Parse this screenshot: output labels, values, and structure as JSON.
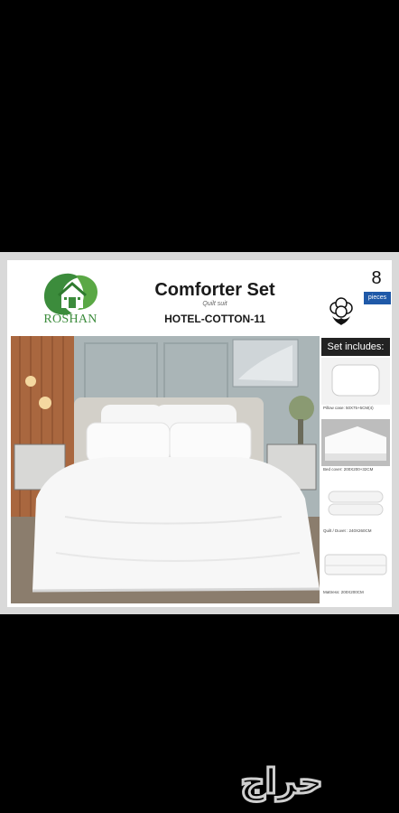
{
  "brand": {
    "name": "ROSHAN",
    "color": "#3c8c3c"
  },
  "product": {
    "title": "Comforter Set",
    "subtitle": "Quilt suit",
    "model": "HOTEL-COTTON-11",
    "piece_count": "8",
    "piece_label": "pieces"
  },
  "icons": [
    "house-leaf-logo",
    "cotton-flower-icon"
  ],
  "set_includes": {
    "header": "Set includes:",
    "items": [
      {
        "caption": "Pillow case: 50X75+5CM(4)"
      },
      {
        "caption": "Bed cover: 200X200+32CM"
      },
      {
        "caption": "Quilt / Duvet : 240X260CM"
      },
      {
        "caption": "Mattress: 200X200CM"
      }
    ]
  },
  "watermark": {
    "text": "حراج"
  },
  "colors": {
    "accent_blue": "#1f59a8",
    "panel_dark": "#222222"
  }
}
